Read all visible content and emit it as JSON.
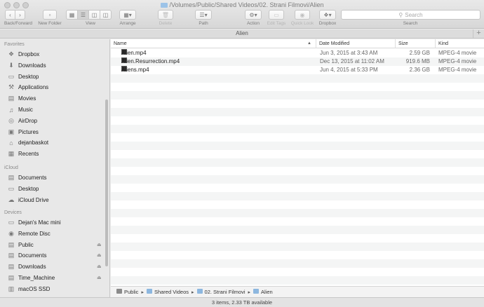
{
  "window": {
    "title": "/Volumes/Public/Shared Videos/02. Strani Filmovi/Alien",
    "tab_title": "Alien",
    "tab_add": "+"
  },
  "toolbar": {
    "back_forward_label": "Back/Forward",
    "new_folder_label": "New Folder",
    "view_label": "View",
    "arrange_label": "Arrange",
    "delete_label": "Delete",
    "path_label": "Path",
    "action_label": "Action",
    "edit_tags_label": "Edit Tags",
    "quick_look_label": "Quick Look",
    "dropbox_label": "Dropbox",
    "search_label": "Search",
    "search_placeholder": "Search",
    "active_view": "list"
  },
  "sidebar": {
    "favorites_title": "Favorites",
    "favorites": [
      {
        "label": "Dropbox",
        "icon": "dropbox-icon"
      },
      {
        "label": "Downloads",
        "icon": "downloads-icon"
      },
      {
        "label": "Desktop",
        "icon": "desktop-icon"
      },
      {
        "label": "Applications",
        "icon": "applications-icon"
      },
      {
        "label": "Movies",
        "icon": "movies-icon"
      },
      {
        "label": "Music",
        "icon": "music-icon"
      },
      {
        "label": "AirDrop",
        "icon": "airdrop-icon"
      },
      {
        "label": "Pictures",
        "icon": "pictures-icon"
      },
      {
        "label": "dejanbaskot",
        "icon": "home-icon"
      },
      {
        "label": "Recents",
        "icon": "recents-icon"
      }
    ],
    "icloud_title": "iCloud",
    "icloud": [
      {
        "label": "Documents",
        "icon": "documents-icon"
      },
      {
        "label": "Desktop",
        "icon": "desktop-icon"
      },
      {
        "label": "iCloud Drive",
        "icon": "icloud-icon"
      }
    ],
    "devices_title": "Devices",
    "devices": [
      {
        "label": "Dejan's Mac mini",
        "icon": "computer-icon",
        "eject": false
      },
      {
        "label": "Remote Disc",
        "icon": "disc-icon",
        "eject": false
      },
      {
        "label": "Public",
        "icon": "network-drive-icon",
        "eject": true
      },
      {
        "label": "Documents",
        "icon": "network-drive-icon",
        "eject": true
      },
      {
        "label": "Downloads",
        "icon": "network-drive-icon",
        "eject": true
      },
      {
        "label": "Time_Machine",
        "icon": "network-drive-icon",
        "eject": true
      },
      {
        "label": "macOS SSD",
        "icon": "internal-drive-icon",
        "eject": false
      }
    ]
  },
  "columns": {
    "name": "Name",
    "date_modified": "Date Modified",
    "size": "Size",
    "kind": "Kind"
  },
  "files": [
    {
      "name": "Alien.mp4",
      "date": "Jun 3, 2015 at 3:43 AM",
      "size": "2.59 GB",
      "kind": "MPEG-4 movie"
    },
    {
      "name": "Alien.Resurrection.mp4",
      "date": "Dec 13, 2015 at 11:02 AM",
      "size": "919.6 MB",
      "kind": "MPEG-4 movie"
    },
    {
      "name": "Aliens.mp4",
      "date": "Jun 4, 2015 at 5:33 PM",
      "size": "2.36 GB",
      "kind": "MPEG-4 movie"
    }
  ],
  "pathbar": [
    "Public",
    "Shared Videos",
    "02. Strani Filmovi",
    "Alien"
  ],
  "status": "3 items, 2.33 TB available"
}
